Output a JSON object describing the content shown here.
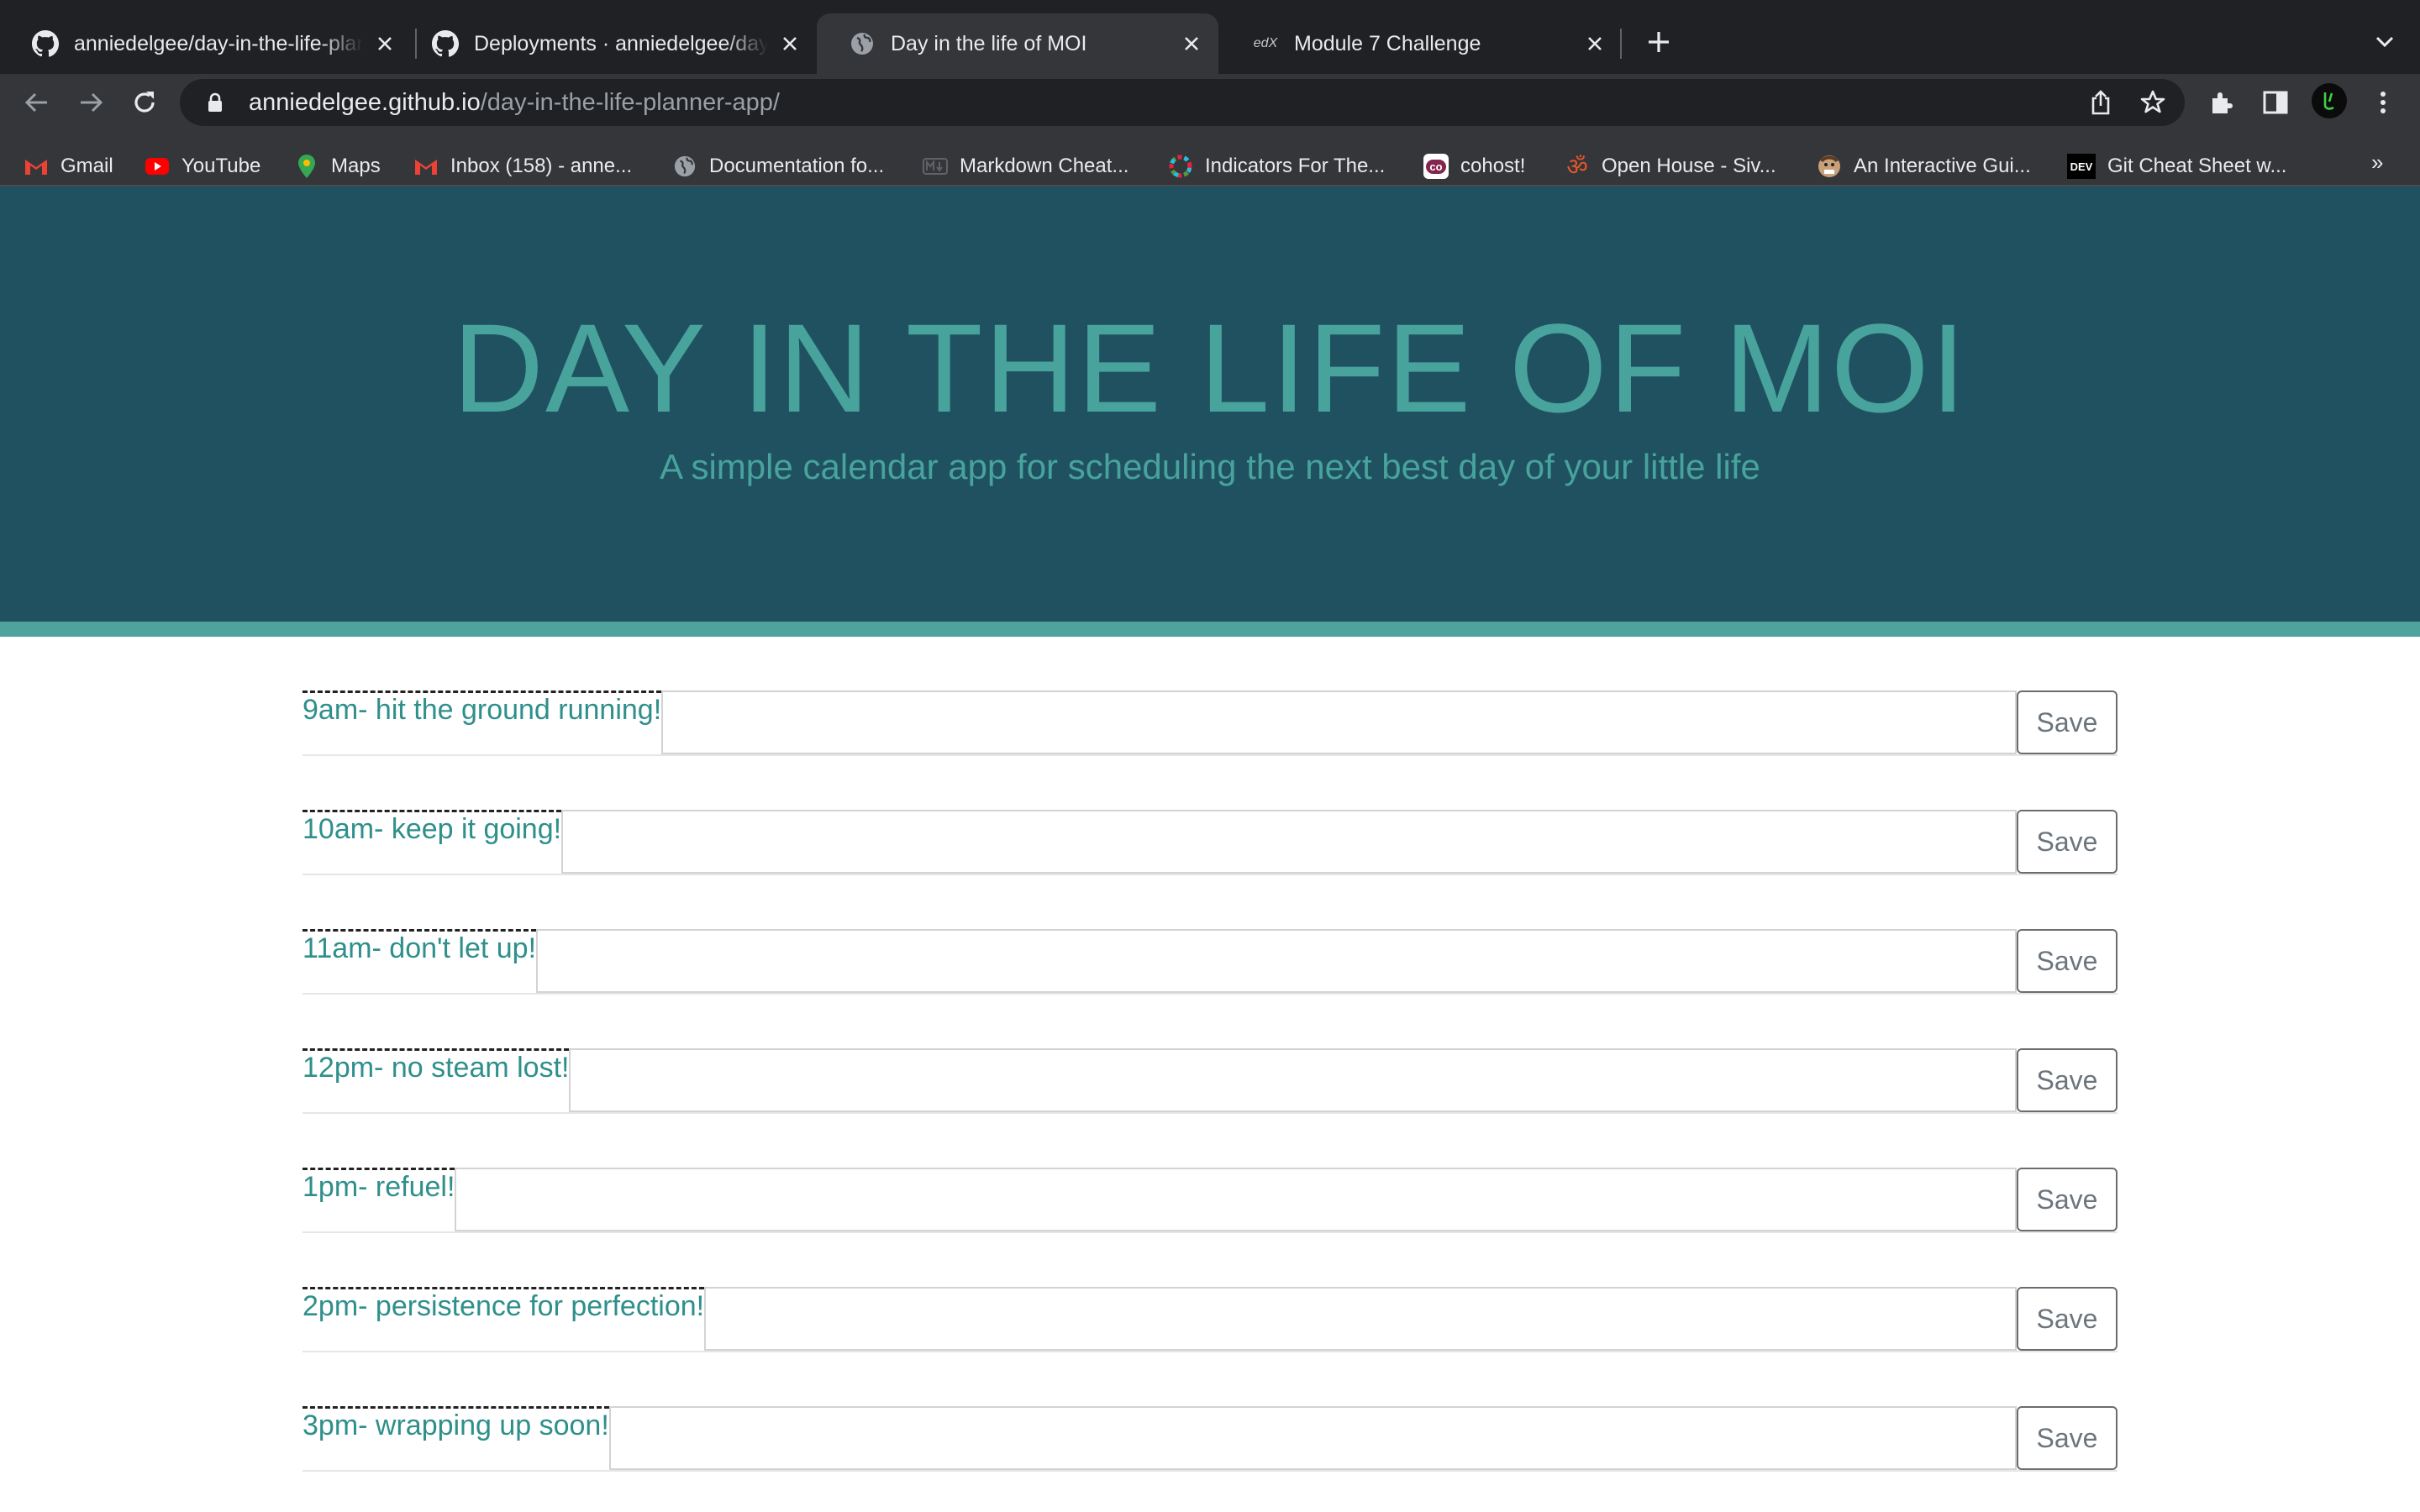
{
  "browser": {
    "tabs": [
      {
        "title": "anniedelgee/day-in-the-life-planner-app",
        "icon": "github-icon"
      },
      {
        "title": "Deployments · anniedelgee/day-in-the-life-planner-app",
        "icon": "github-icon"
      },
      {
        "title": "Day in the life of MOI",
        "icon": "globe-icon",
        "active": true
      },
      {
        "title": "Module 7 Challenge",
        "icon": "edx-icon"
      }
    ],
    "url_host": "anniedelgee.github.io",
    "url_path": "/day-in-the-life-planner-app/",
    "bookmarks": [
      {
        "label": "Gmail",
        "icon": "gmail-icon"
      },
      {
        "label": "YouTube",
        "icon": "youtube-icon"
      },
      {
        "label": "Maps",
        "icon": "maps-icon"
      },
      {
        "label": "Inbox (158) - anne...",
        "icon": "gmail-icon"
      },
      {
        "label": "Documentation fo...",
        "icon": "globe-icon"
      },
      {
        "label": "Markdown Cheat...",
        "icon": "markdown-icon"
      },
      {
        "label": "Indicators For The...",
        "icon": "sdg-icon"
      },
      {
        "label": "cohost!",
        "icon": "cohost-icon"
      },
      {
        "label": "Open House - Siv...",
        "icon": "om-icon"
      },
      {
        "label": "An Interactive Gui...",
        "icon": "avatar-icon"
      },
      {
        "label": "Git Cheat Sheet w...",
        "icon": "dev-icon"
      }
    ],
    "bookmarks_more": "»",
    "edx_label": "edX",
    "dev_label": "DEV",
    "cohost_label": "co",
    "om_label": "ॐ"
  },
  "header": {
    "title": "DAY IN THE LIFE OF MOI",
    "lead": "A simple calendar app for scheduling the next best day of your little life"
  },
  "planner": {
    "save_label": "Save",
    "rows": [
      {
        "hour": "9am- hit the ground running!",
        "text": ""
      },
      {
        "hour": "10am- keep it going!",
        "text": ""
      },
      {
        "hour": "11am- don't let up!",
        "text": ""
      },
      {
        "hour": "12pm- no steam lost!",
        "text": ""
      },
      {
        "hour": "1pm- refuel!",
        "text": ""
      },
      {
        "hour": "2pm- persistence for perfection!",
        "text": ""
      },
      {
        "hour": "3pm- wrapping up soon!",
        "text": ""
      }
    ]
  },
  "colors": {
    "header_bg": "#205160",
    "accent": "#47a39c",
    "hour_text": "#2e8f8b"
  }
}
